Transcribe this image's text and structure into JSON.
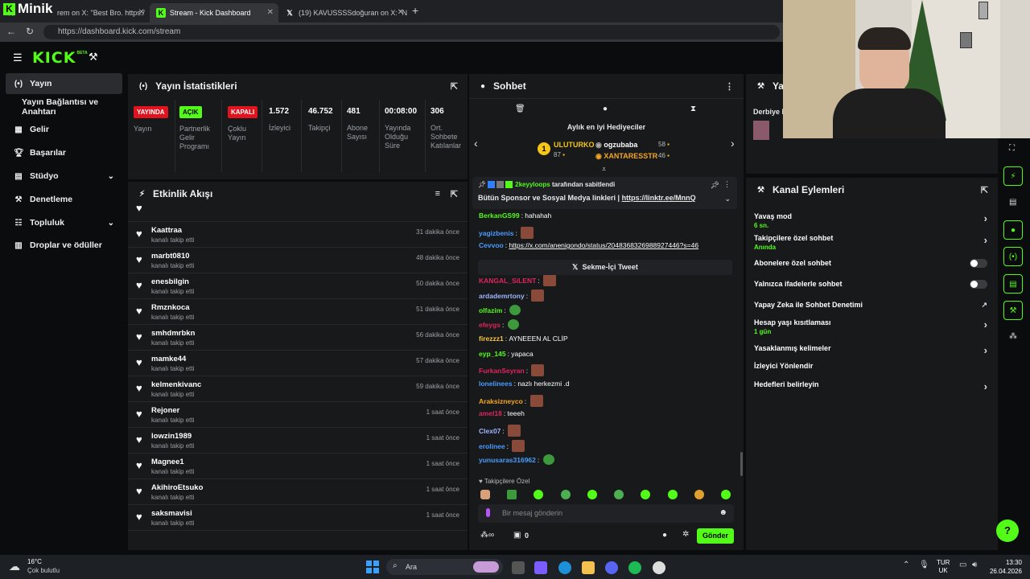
{
  "browser": {
    "tabs": [
      {
        "label": "rem on X: \"Best Bro. https:/"
      },
      {
        "label": "Stream - Kick Dashboard"
      },
      {
        "label": "(19) KAVUSSSSdoğuran on X: \"N"
      }
    ],
    "url": "https://dashboard.kick.com/stream",
    "overlay_text": "Minik"
  },
  "app": {
    "logo": "KICK",
    "logo_sup": "BETA"
  },
  "sidebar": {
    "items": [
      {
        "label": "Yayın"
      },
      {
        "label": "Yayın Bağlantısı ve Anahtarı"
      },
      {
        "label": "Gelir"
      },
      {
        "label": "Başarılar"
      },
      {
        "label": "Stüdyo"
      },
      {
        "label": "Denetleme"
      },
      {
        "label": "Topluluk"
      },
      {
        "label": "Droplar ve ödüller"
      }
    ]
  },
  "stats": {
    "title": "Yayın İstatistikleri",
    "items": [
      {
        "badge": "YAYINDA",
        "label": "Yayın"
      },
      {
        "badge": "AÇIK",
        "label": "Partnerlik Gelir Programı"
      },
      {
        "badge": "KAPALI",
        "label": "Çoklu Yayın"
      },
      {
        "value": "1.572",
        "label": "İzleyici"
      },
      {
        "value": "46.752",
        "label": "Takipçi"
      },
      {
        "value": "481",
        "label": "Abone Sayısı"
      },
      {
        "value": "00:08:00",
        "label": "Yayında Olduğu Süre"
      },
      {
        "value": "306",
        "label": "Ort. Sohbete Katılanlar"
      }
    ]
  },
  "activity": {
    "title": "Etkinlik Akışı",
    "sub": "kanalı takip etti",
    "items": [
      {
        "name": "Kaattraa",
        "time": "31 dakika önce"
      },
      {
        "name": "marbt0810",
        "time": "48 dakika önce"
      },
      {
        "name": "enesbilgin",
        "time": "50 dakika önce"
      },
      {
        "name": "Rmznkoca",
        "time": "51 dakika önce"
      },
      {
        "name": "smhdmrbkn",
        "time": "56 dakika önce"
      },
      {
        "name": "mamke44",
        "time": "57 dakika önce"
      },
      {
        "name": "kelmenkivanc",
        "time": "59 dakika önce"
      },
      {
        "name": "Rejoner",
        "time": "1 saat önce"
      },
      {
        "name": "lowzin1989",
        "time": "1 saat önce"
      },
      {
        "name": "Magnee1",
        "time": "1 saat önce"
      },
      {
        "name": "AkihiroEtsuko",
        "time": "1 saat önce"
      },
      {
        "name": "saksmavisi",
        "time": "1 saat önce"
      }
    ]
  },
  "chat": {
    "title": "Sohbet",
    "gifters_title": "Aylık en iyi Hediyeciler",
    "gifters": [
      {
        "rank": "1",
        "name": "ULUTURKO",
        "count": "87"
      },
      {
        "name": "ogzubaba",
        "count": "58"
      },
      {
        "name": "XANTARESSTR",
        "count": "46"
      }
    ],
    "pinned_by": "2keyyloops",
    "pinned_by_suffix": "tarafından sabitlendi",
    "pinned_text": "Bütün Sponsor ve Sosyal Medya linkleri |",
    "pinned_link": "https://linktr.ee/MnnQ",
    "messages": [
      {
        "user": "BerkanGS99",
        "text": "hahahah",
        "color": "#53fc18"
      },
      {
        "user": "yagizbenis",
        "text": "",
        "color": "#4a9cff",
        "emote": true
      },
      {
        "user": "Cevvoo",
        "text": "https://x.com/anenigondo/status/2048368326988927446?s=46",
        "color": "#4a9cff",
        "link": true
      },
      {
        "user": "KANGAL_SiLENT",
        "text": "",
        "color": "#e0245e",
        "emote": true
      },
      {
        "user": "ardademrtony",
        "text": "",
        "color": "#9fb4ff",
        "emote": true
      },
      {
        "user": "olfazim",
        "text": "",
        "color": "#53fc18",
        "emote": true,
        "green": true
      },
      {
        "user": "efeygs",
        "text": "",
        "color": "#e0245e",
        "emote": true,
        "green": true
      },
      {
        "user": "firezzz1",
        "text": "AYNEEEN AL CLİP",
        "color": "#f5c542"
      },
      {
        "user": "eyp_145",
        "text": "yapaca",
        "color": "#53fc18"
      },
      {
        "user": "FurkanSeyran",
        "text": "",
        "color": "#e0245e",
        "emote": true
      },
      {
        "user": "lonelinees",
        "text": "nazlı herkezmi .d",
        "color": "#4a9cff"
      },
      {
        "user": "Araksizneyco",
        "text": "",
        "color": "#f5a623",
        "emote": true
      },
      {
        "user": "amel18",
        "text": "teeeh",
        "color": "#e0245e"
      },
      {
        "user": "Clex07",
        "text": "",
        "color": "#9fb4ff",
        "emote": true
      },
      {
        "user": "erolinee",
        "text": "",
        "color": "#4a9cff",
        "emote": true
      },
      {
        "user": "yunusaras316962",
        "text": "",
        "color": "#4a9cff",
        "emote": true,
        "green": true
      }
    ],
    "tweet_btn": "Sekme-İçi Tweet",
    "followers_only": "Takipçilere Özel",
    "input_placeholder": "Bir mesaj gönderin",
    "points": "0",
    "send": "Gönder"
  },
  "actions": {
    "title": "Kanal Eylemleri",
    "partial_title": "Ya",
    "partial_text": "Derbiye k",
    "rows": [
      {
        "label": "Yavaş mod",
        "sub": "6 sn."
      },
      {
        "label": "Takipçilere özel sohbet",
        "sub": "Anında"
      },
      {
        "label": "Abonelere özel sohbet"
      },
      {
        "label": "Yalnızca ifadelerle sohbet"
      },
      {
        "label": "Yapay Zeka ile Sohbet Denetimi"
      },
      {
        "label": "Hesap yaşı kısıtlaması",
        "sub": "1 gün"
      },
      {
        "label": "Yasaklanmış kelimeler"
      },
      {
        "label": "İzleyici Yönlendir"
      },
      {
        "label": "Hedefleri belirleyin"
      }
    ]
  },
  "taskbar": {
    "temp": "16°C",
    "weather": "Çok bulutlu",
    "search": "Ara",
    "lang1": "TUR",
    "lang2": "UK",
    "time": "13:30",
    "date": "26.04.2026"
  }
}
